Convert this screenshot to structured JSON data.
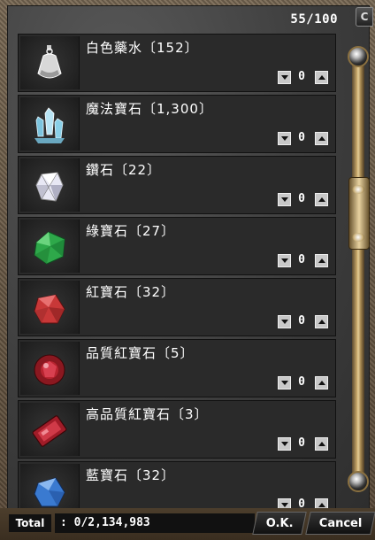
{
  "header": {
    "slot_count": "55/100",
    "corner_label": "C"
  },
  "items": [
    {
      "name": "白色藥水〔152〕",
      "icon": "white-potion-icon",
      "quantity": "0",
      "color": "#e8e8e8"
    },
    {
      "name": "魔法寶石〔1,300〕",
      "icon": "magic-crystal-icon",
      "quantity": "0",
      "color": "#8fd0e8"
    },
    {
      "name": "鑽石〔22〕",
      "icon": "diamond-icon",
      "quantity": "0",
      "color": "#ffffff"
    },
    {
      "name": "綠寶石〔27〕",
      "icon": "emerald-icon",
      "quantity": "0",
      "color": "#2ea84a"
    },
    {
      "name": "紅寶石〔32〕",
      "icon": "ruby-icon",
      "quantity": "0",
      "color": "#c83838"
    },
    {
      "name": "品質紅寶石〔5〕",
      "icon": "quality-ruby-icon",
      "quantity": "0",
      "color": "#a0202a"
    },
    {
      "name": "高品質紅寶石〔3〕",
      "icon": "high-quality-ruby-icon",
      "quantity": "0",
      "color": "#b02030"
    },
    {
      "name": "藍寶石〔32〕",
      "icon": "sapphire-icon",
      "quantity": "0",
      "color": "#3a7ad0"
    }
  ],
  "footer": {
    "total_label": "Total",
    "total_value": ": 0/2,134,983",
    "ok_label": "O.K.",
    "cancel_label": "Cancel"
  }
}
